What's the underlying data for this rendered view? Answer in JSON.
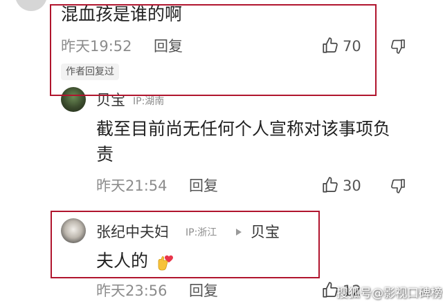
{
  "comments": [
    {
      "text": "混血孩是谁的啊",
      "time": "昨天19:52",
      "reply_label": "回复",
      "likes": "70",
      "author_tag": "作者回复过"
    },
    {
      "user_name": "贝宝",
      "ip": "IP:湖南",
      "text_line1": "截至目前尚无任何个人宣称对该事项负",
      "text_line2": "责",
      "time": "昨天21:54",
      "reply_label": "回复",
      "likes": "30"
    },
    {
      "user_name": "张纪中夫妇",
      "ip": "IP:浙江",
      "reply_to": "贝宝",
      "text": "夫人的",
      "time": "昨天23:56",
      "reply_label": "回复",
      "likes": "12"
    }
  ],
  "watermark": "搜狐号@影视口碑榜",
  "colors": {
    "highlight_border": "#b0142d",
    "meta_gray": "#8c8c8c",
    "text": "#222222"
  },
  "icons": [
    "thumbs-up-icon",
    "thumbs-down-icon",
    "heart-hand-emoji",
    "play-arrow-icon"
  ]
}
